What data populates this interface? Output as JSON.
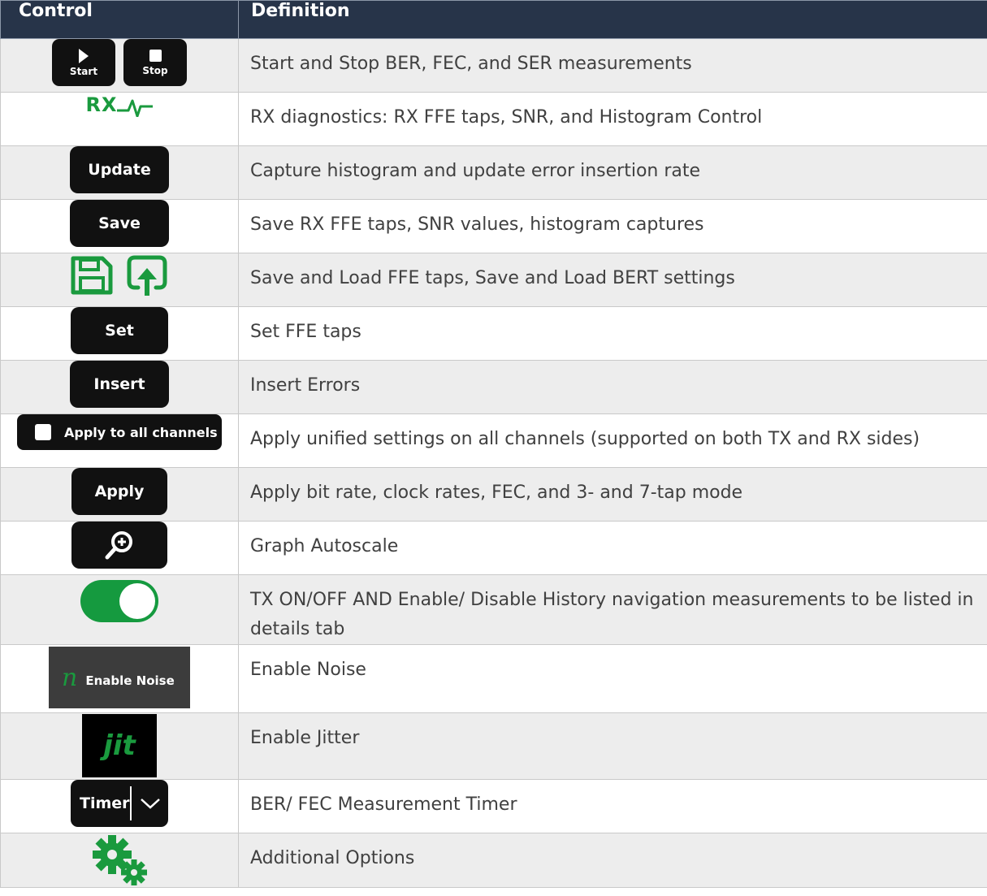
{
  "header": {
    "control": "Control",
    "definition": "Definition"
  },
  "rows": [
    {
      "definition": "Start and Stop BER, FEC, and SER measurements",
      "start_label": "Start",
      "stop_label": "Stop"
    },
    {
      "definition": "RX diagnostics: RX FFE taps, SNR, and Histogram Control",
      "rx_label": "RX"
    },
    {
      "definition": "Capture histogram and update error insertion rate",
      "button_label": "Update"
    },
    {
      "definition": "Save RX FFE taps, SNR values, histogram captures",
      "button_label": "Save"
    },
    {
      "definition": "Save and Load FFE taps, Save and Load BERT settings"
    },
    {
      "definition": "Set FFE taps",
      "button_label": "Set"
    },
    {
      "definition": "Insert Errors",
      "button_label": "Insert"
    },
    {
      "definition": "Apply unified settings on all channels (supported on both TX and RX sides)",
      "button_label": "Apply to all channels"
    },
    {
      "definition": "Apply bit rate, clock rates, FEC, and 3- and 7-tap mode",
      "button_label": "Apply"
    },
    {
      "definition": "Graph Autoscale"
    },
    {
      "definition": "TX ON/OFF AND Enable/ Disable History navigation measurements to be listed in details tab"
    },
    {
      "definition": "Enable Noise",
      "glyph": "n",
      "button_label": "Enable Noise"
    },
    {
      "definition": "Enable Jitter",
      "button_label": "jit"
    },
    {
      "definition": "BER/ FEC Measurement Timer",
      "button_label": "Timer"
    },
    {
      "definition": "Additional Options"
    }
  ],
  "colors": {
    "header_bg": "#273449",
    "accent_green": "#1a9a3e",
    "button_black": "#111111"
  }
}
